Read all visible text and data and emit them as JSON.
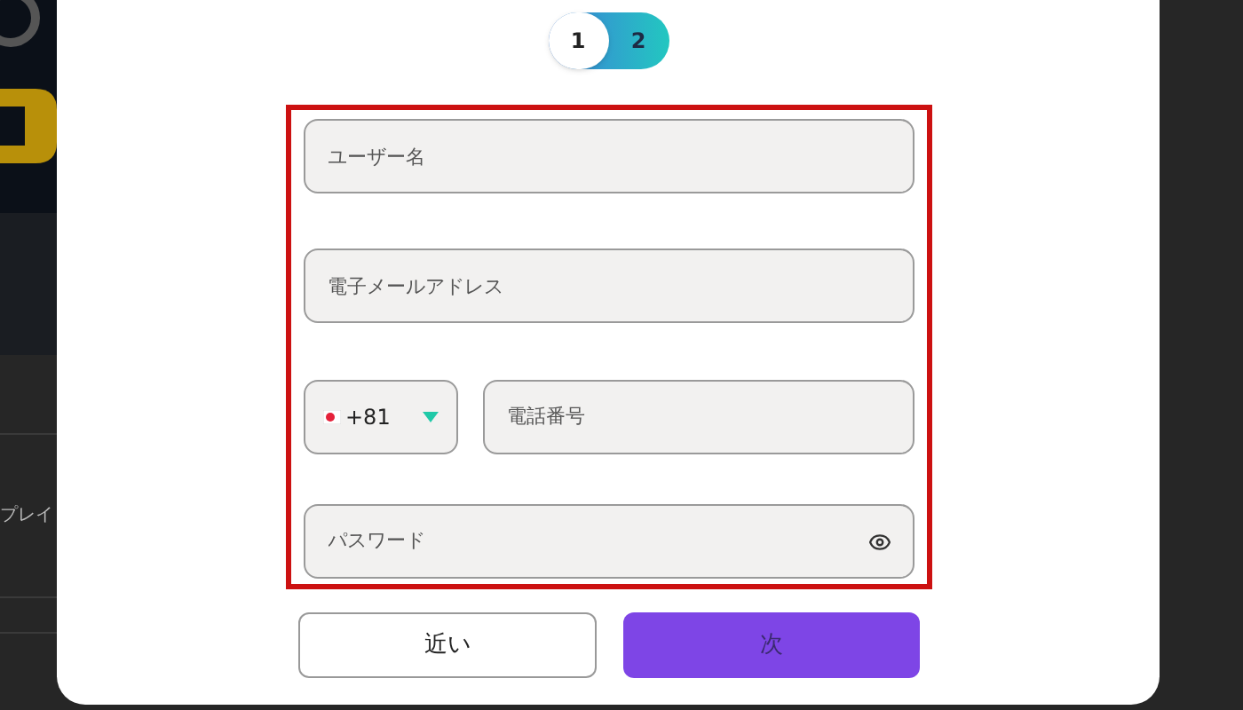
{
  "background": {
    "side_text": "プレイ"
  },
  "stepper": [
    {
      "label": "1",
      "selected": false
    },
    {
      "label": "2",
      "selected": true
    }
  ],
  "form": {
    "username": {
      "placeholder": "ユーザー名"
    },
    "email": {
      "placeholder": "電子メールアドレス"
    },
    "phone": {
      "country_code": "+81",
      "placeholder": "電話番号"
    },
    "password": {
      "placeholder": "パスワード"
    }
  },
  "buttons": [
    {
      "label": "近い",
      "kind": "secondary"
    },
    {
      "label": "次",
      "kind": "primary"
    }
  ]
}
